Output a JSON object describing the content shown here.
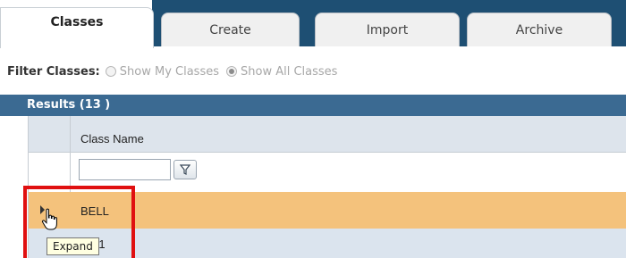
{
  "tabs": [
    {
      "label": "Classes",
      "active": true
    },
    {
      "label": "Create",
      "active": false
    },
    {
      "label": "Import",
      "active": false
    },
    {
      "label": "Archive",
      "active": false
    }
  ],
  "filter": {
    "label": "Filter Classes:",
    "options": [
      {
        "label": "Show My Classes",
        "checked": false
      },
      {
        "label": "Show All Classes",
        "checked": true
      }
    ]
  },
  "results": {
    "label": "Results  (13 )"
  },
  "grid": {
    "column_header": "Class Name",
    "filter_value": "",
    "rows": [
      {
        "name": "BELL",
        "selected": true
      },
      {
        "name": "T 1",
        "selected": false
      }
    ]
  },
  "tooltip": {
    "text": "Expand"
  },
  "colors": {
    "header_bar": "#1e4f73",
    "results_bar": "#3b6a92",
    "row_highlight": "#f4c27c",
    "row_alt": "#dbe4ee",
    "annotation": "#e01010"
  },
  "icons": {
    "filter_button": "funnel-icon",
    "expand_toggle": "triangle-right-icon",
    "cursor": "hand-pointer-icon"
  }
}
